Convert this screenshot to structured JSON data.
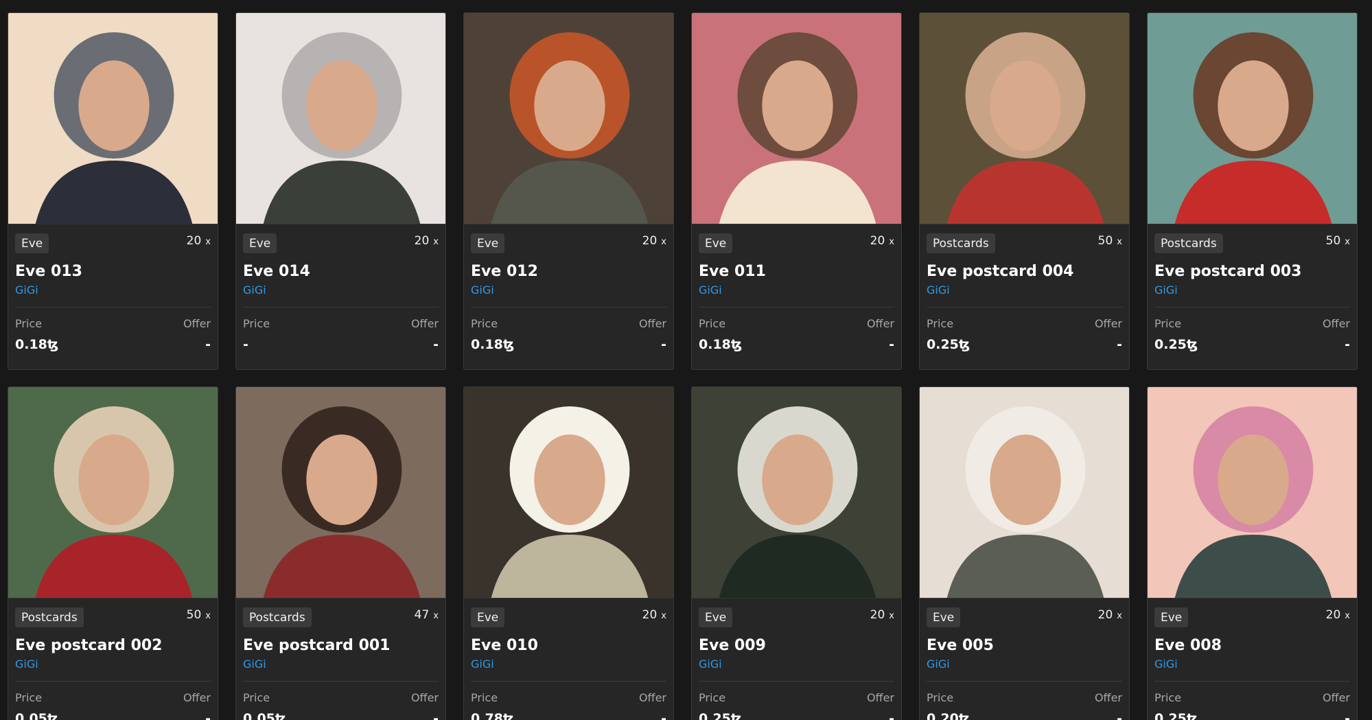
{
  "labels": {
    "price": "Price",
    "offer": "Offer",
    "qty_suffix": "x"
  },
  "cards": [
    {
      "category": "Eve",
      "qty": "20",
      "name": "Eve 013",
      "creator": "GiGi",
      "price": "0.18ꜩ",
      "offer": "-",
      "colors": [
        "#f0dcc4",
        "#6a6d74",
        "#2c2f3a"
      ]
    },
    {
      "category": "Eve",
      "qty": "20",
      "name": "Eve 014",
      "creator": "GiGi",
      "price": "-",
      "offer": "-",
      "colors": [
        "#e9e3df",
        "#b8b3b3",
        "#3a3f3a"
      ]
    },
    {
      "category": "Eve",
      "qty": "20",
      "name": "Eve 012",
      "creator": "GiGi",
      "price": "0.18ꜩ",
      "offer": "-",
      "colors": [
        "#4e4238",
        "#b8532a",
        "#56574c"
      ]
    },
    {
      "category": "Eve",
      "qty": "20",
      "name": "Eve 011",
      "creator": "GiGi",
      "price": "0.18ꜩ",
      "offer": "-",
      "colors": [
        "#c9727a",
        "#6e4c3e",
        "#f3e4cf"
      ]
    },
    {
      "category": "Postcards",
      "qty": "50",
      "name": "Eve postcard 004",
      "creator": "GiGi",
      "price": "0.25ꜩ",
      "offer": "-",
      "colors": [
        "#5c5138",
        "#c9a386",
        "#b8352f"
      ]
    },
    {
      "category": "Postcards",
      "qty": "50",
      "name": "Eve postcard 003",
      "creator": "GiGi",
      "price": "0.25ꜩ",
      "offer": "-",
      "colors": [
        "#6f9c95",
        "#6a4633",
        "#c62c2a"
      ]
    },
    {
      "category": "Postcards",
      "qty": "50",
      "name": "Eve postcard 002",
      "creator": "GiGi",
      "price": "0.05ꜩ",
      "offer": "-",
      "colors": [
        "#4f6a4a",
        "#d8c6ac",
        "#a8242a"
      ]
    },
    {
      "category": "Postcards",
      "qty": "47",
      "name": "Eve postcard 001",
      "creator": "GiGi",
      "price": "0.05ꜩ",
      "offer": "-",
      "colors": [
        "#7d6b5e",
        "#3a2a24",
        "#8b2c2c"
      ]
    },
    {
      "category": "Eve",
      "qty": "20",
      "name": "Eve 010",
      "creator": "GiGi",
      "price": "0.78ꜩ",
      "offer": "-",
      "colors": [
        "#3a332c",
        "#f4f1e6",
        "#bdb59c"
      ]
    },
    {
      "category": "Eve",
      "qty": "20",
      "name": "Eve 009",
      "creator": "GiGi",
      "price": "0.25ꜩ",
      "offer": "-",
      "colors": [
        "#3e4236",
        "#d8d8cf",
        "#1e2a22"
      ]
    },
    {
      "category": "Eve",
      "qty": "20",
      "name": "Eve 005",
      "creator": "GiGi",
      "price": "0.20ꜩ",
      "offer": "-",
      "colors": [
        "#e6ddd4",
        "#f0ece5",
        "#5a5e55"
      ]
    },
    {
      "category": "Eve",
      "qty": "20",
      "name": "Eve 008",
      "creator": "GiGi",
      "price": "0.25ꜩ",
      "offer": "-",
      "colors": [
        "#f2c6b8",
        "#d98aa6",
        "#3d4d4a"
      ]
    }
  ]
}
